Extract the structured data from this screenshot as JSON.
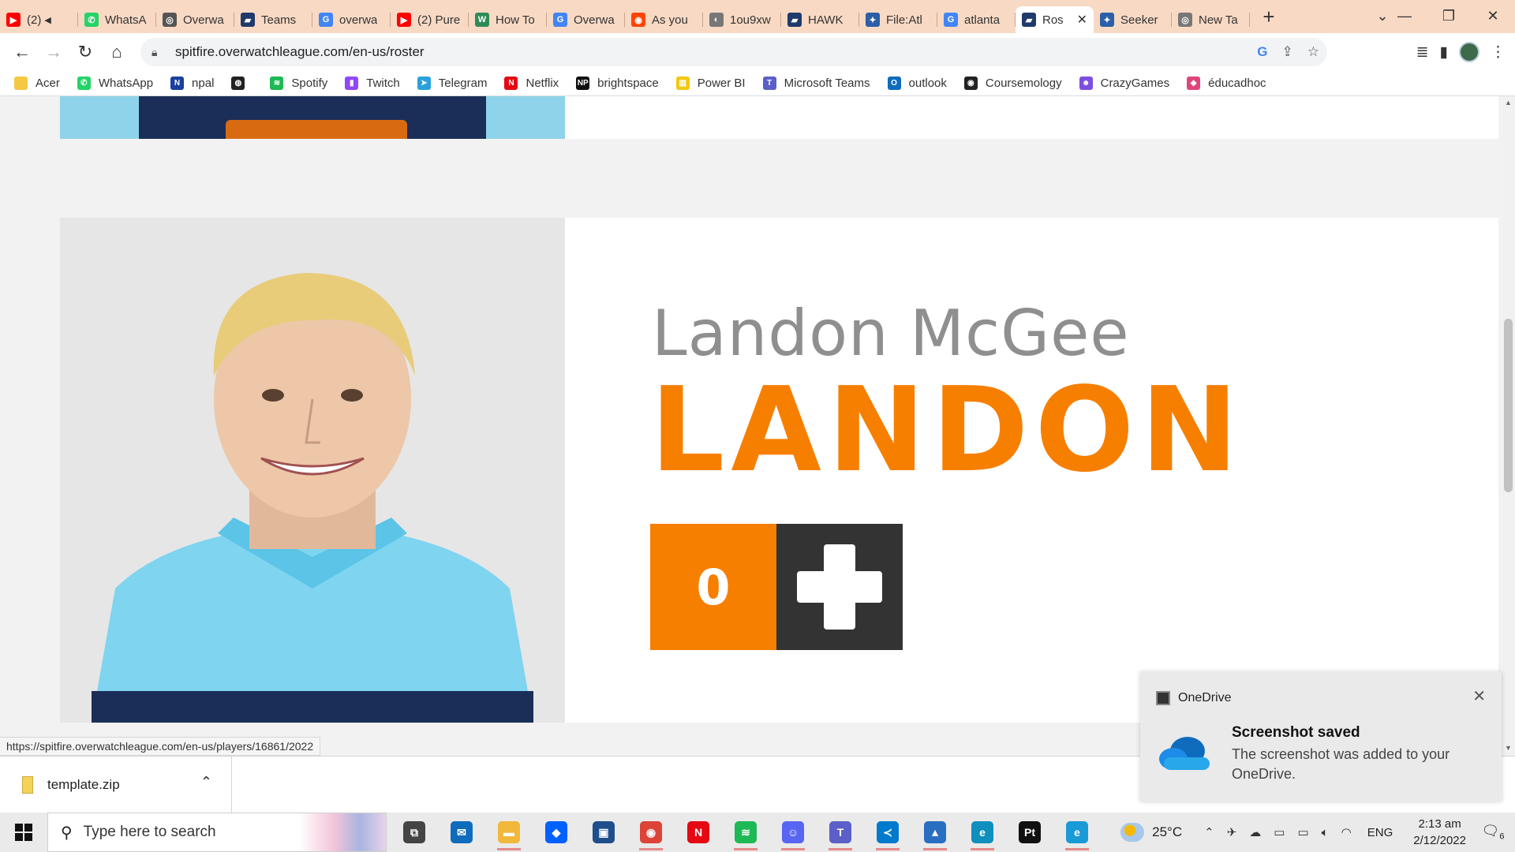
{
  "browser": {
    "tabs": [
      {
        "label": "(2)",
        "color": "#ff0000",
        "icon": "youtube-icon",
        "glyph": "▶",
        "muted": true
      },
      {
        "label": "WhatsA",
        "color": "#25d366",
        "icon": "whatsapp-icon",
        "glyph": "✆"
      },
      {
        "label": "Overwa",
        "color": "#555555",
        "icon": "overwatch-icon",
        "glyph": "◎"
      },
      {
        "label": "Teams",
        "color": "#1f3a6b",
        "icon": "teams-page-icon",
        "glyph": "▰"
      },
      {
        "label": "overwa",
        "color": "#4285f4",
        "icon": "google-icon",
        "glyph": "G"
      },
      {
        "label": "(2) Pure",
        "color": "#ff0000",
        "icon": "youtube-icon",
        "glyph": "▶"
      },
      {
        "label": "How To",
        "color": "#2e8b57",
        "icon": "wikihow-icon",
        "glyph": "W"
      },
      {
        "label": "Overwa",
        "color": "#4285f4",
        "icon": "google-icon",
        "glyph": "G"
      },
      {
        "label": "As you",
        "color": "#ff4500",
        "icon": "reddit-icon",
        "glyph": "◉"
      },
      {
        "label": "1ou9xw",
        "color": "#777777",
        "icon": "globe-icon",
        "glyph": "◐"
      },
      {
        "label": "HAWK",
        "color": "#1f3a6b",
        "icon": "team-page-icon",
        "glyph": "▰"
      },
      {
        "label": "File:Atl",
        "color": "#2b5fa8",
        "icon": "wiki-icon",
        "glyph": "✦"
      },
      {
        "label": "atlanta",
        "color": "#4285f4",
        "icon": "google-icon",
        "glyph": "G"
      },
      {
        "label": "Ros",
        "color": "#1f3a6b",
        "icon": "team-page-icon",
        "glyph": "▰",
        "active": true
      },
      {
        "label": "Seeker",
        "color": "#2b5fa8",
        "icon": "wiki-icon",
        "glyph": "✦"
      },
      {
        "label": "New Ta",
        "color": "#777777",
        "icon": "chrome-icon",
        "glyph": "◎"
      }
    ],
    "url": "spitfire.overwatchleague.com/en-us/roster",
    "status_url": "https://spitfire.overwatchleague.com/en-us/players/16861/2022"
  },
  "bookmarks": [
    {
      "label": "Acer",
      "color": "#f5c842",
      "icon": "folder-icon",
      "glyph": ""
    },
    {
      "label": "WhatsApp",
      "color": "#25d366",
      "icon": "whatsapp-icon",
      "glyph": "✆"
    },
    {
      "label": "npal",
      "color": "#1a3fa0",
      "icon": "npal-icon",
      "glyph": "N"
    },
    {
      "label": "",
      "color": "#222222",
      "icon": "globe-icon",
      "glyph": "◍"
    },
    {
      "label": "Spotify",
      "color": "#1db954",
      "icon": "spotify-icon",
      "glyph": "≋"
    },
    {
      "label": "Twitch",
      "color": "#9146ff",
      "icon": "twitch-icon",
      "glyph": "▮"
    },
    {
      "label": "Telegram",
      "color": "#2aa1da",
      "icon": "telegram-icon",
      "glyph": "➤"
    },
    {
      "label": "Netflix",
      "color": "#e50914",
      "icon": "netflix-icon",
      "glyph": "N"
    },
    {
      "label": "brightspace",
      "color": "#111111",
      "icon": "np-icon",
      "glyph": "NP"
    },
    {
      "label": "Power BI",
      "color": "#f2c811",
      "icon": "powerbi-icon",
      "glyph": "▥"
    },
    {
      "label": "Microsoft Teams",
      "color": "#5b5fc7",
      "icon": "msteams-icon",
      "glyph": "T"
    },
    {
      "label": "outlook",
      "color": "#0f6cbd",
      "icon": "outlook-icon",
      "glyph": "O"
    },
    {
      "label": "Coursemology",
      "color": "#222222",
      "icon": "coursemology-icon",
      "glyph": "◉"
    },
    {
      "label": "CrazyGames",
      "color": "#7b4fe0",
      "icon": "crazygames-icon",
      "glyph": "☻"
    },
    {
      "label": "éducadhoc",
      "color": "#e0457b",
      "icon": "educadhoc-icon",
      "glyph": "◆"
    }
  ],
  "player": {
    "real_name": "Landon McGee",
    "handle": "LANDON",
    "number": "0",
    "role_icon": "support-plus-icon",
    "accent": "#f77f00",
    "role_bg": "#333333"
  },
  "downloads": {
    "file": "template.zip"
  },
  "toast": {
    "app": "OneDrive",
    "title": "Screenshot saved",
    "body": "The screenshot was added to your OneDrive."
  },
  "taskbar": {
    "search_placeholder": "Type here to search",
    "apps": [
      {
        "name": "task-view",
        "color": "#444444",
        "glyph": "⧉",
        "running": false
      },
      {
        "name": "mail",
        "color": "#0f6cbd",
        "glyph": "✉",
        "running": false
      },
      {
        "name": "file-explorer",
        "color": "#f2b83b",
        "glyph": "▬",
        "running": true
      },
      {
        "name": "dropbox",
        "color": "#0061fe",
        "glyph": "◆",
        "running": false
      },
      {
        "name": "visual-studio",
        "color": "#1e4e8c",
        "glyph": "▣",
        "running": false
      },
      {
        "name": "chrome",
        "color": "#db4437",
        "glyph": "◉",
        "running": true
      },
      {
        "name": "netflix",
        "color": "#e50914",
        "glyph": "N",
        "running": false
      },
      {
        "name": "spotify",
        "color": "#1db954",
        "glyph": "≋",
        "running": true
      },
      {
        "name": "discord",
        "color": "#5865f2",
        "glyph": "☺",
        "running": true
      },
      {
        "name": "teams",
        "color": "#5b5fc7",
        "glyph": "T",
        "running": true
      },
      {
        "name": "vscode",
        "color": "#007acc",
        "glyph": "≺",
        "running": true
      },
      {
        "name": "photos",
        "color": "#2a6ec2",
        "glyph": "▲",
        "running": true
      },
      {
        "name": "edge",
        "color": "#0e8fbd",
        "glyph": "e",
        "running": true
      },
      {
        "name": "pycharm",
        "color": "#111111",
        "glyph": "Pt",
        "running": false
      },
      {
        "name": "edge-dev",
        "color": "#1a9ad6",
        "glyph": "e",
        "running": true
      }
    ],
    "weather": "25°C",
    "language": "ENG",
    "time": "2:13 am",
    "date": "2/12/2022",
    "notifications": "6"
  }
}
